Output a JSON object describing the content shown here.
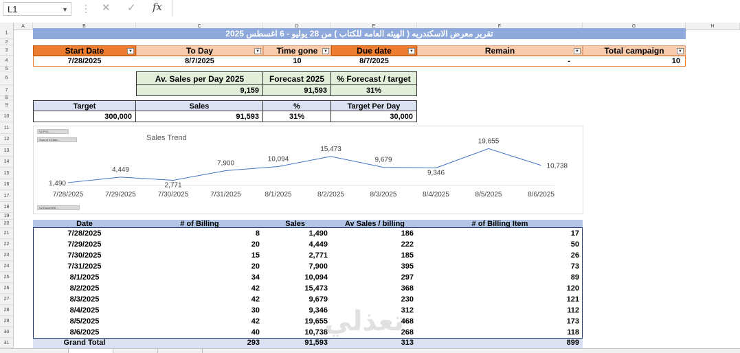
{
  "formula_bar": {
    "name_box": "L1",
    "cancel_icon": "✕",
    "enter_icon": "✓",
    "fx_label": "fx",
    "formula": ""
  },
  "columns": [
    "A",
    "B",
    "C",
    "D",
    "E",
    "F",
    "G",
    "H"
  ],
  "rows": [
    "1",
    "2",
    "3",
    "4",
    "5",
    "6",
    "7",
    "8",
    "9",
    "10",
    "11",
    "12",
    "13",
    "14",
    "15",
    "16",
    "17",
    "18",
    "19",
    "20",
    "21",
    "22",
    "23",
    "24",
    "25",
    "26",
    "27",
    "28",
    "29",
    "30",
    "31"
  ],
  "title": "تقرير معرض الاسكندريه ( الهيئه العامه للكتاب )   من 28 يوليو - 6 اغسطس  2025",
  "campaign": {
    "headers": [
      "Start Date",
      "To Day",
      "Time gone",
      "Due date",
      "Remain",
      "Total campaign"
    ],
    "values": [
      "7/28/2025",
      "8/7/2025",
      "10",
      "8/7/2025",
      "-",
      "10"
    ]
  },
  "forecast": {
    "headers": [
      "Av. Sales per Day 2025",
      "Forecast 2025",
      "% Forecast / target"
    ],
    "values": [
      "9,159",
      "91,593",
      "31%"
    ]
  },
  "target": {
    "headers": [
      "Target",
      "Sales",
      "%",
      "Target Per Day"
    ],
    "values": [
      "300,000",
      "91,593",
      "31%",
      "30,000"
    ]
  },
  "chart_buttons": {
    "filter": "V2.PGI...",
    "values": "Sum of V2.Net...",
    "axis": "V2.Document ..."
  },
  "chart_data": {
    "type": "line",
    "title": "Sales Trend",
    "categories": [
      "7/28/2025",
      "7/29/2025",
      "7/30/2025",
      "7/31/2025",
      "8/1/2025",
      "8/2/2025",
      "8/3/2025",
      "8/4/2025",
      "8/5/2025",
      "8/6/2025"
    ],
    "values": [
      1490,
      4449,
      2771,
      7900,
      10094,
      15473,
      9679,
      9346,
      19655,
      10738
    ],
    "labels": [
      "1,490",
      "4,449",
      "2,771",
      "7,900",
      "10,094",
      "15,473",
      "9,679",
      "9,346",
      "19,655",
      "10,738"
    ],
    "ylim": [
      0,
      22000
    ],
    "color": "#4472c4"
  },
  "pivot": {
    "headers": [
      "Date",
      "# of Billing",
      "Sales",
      "Av  Sales / billing",
      "# of Billing Item"
    ],
    "rows": [
      [
        "7/28/2025",
        "8",
        "1,490",
        "186",
        "17"
      ],
      [
        "7/29/2025",
        "20",
        "4,449",
        "222",
        "50"
      ],
      [
        "7/30/2025",
        "15",
        "2,771",
        "185",
        "26"
      ],
      [
        "7/31/2025",
        "20",
        "7,900",
        "395",
        "73"
      ],
      [
        "8/1/2025",
        "34",
        "10,094",
        "297",
        "89"
      ],
      [
        "8/2/2025",
        "42",
        "15,473",
        "368",
        "120"
      ],
      [
        "8/3/2025",
        "42",
        "9,679",
        "230",
        "121"
      ],
      [
        "8/4/2025",
        "30",
        "9,346",
        "312",
        "112"
      ],
      [
        "8/5/2025",
        "42",
        "19,655",
        "468",
        "173"
      ],
      [
        "8/6/2025",
        "40",
        "10,738",
        "268",
        "118"
      ]
    ],
    "total": [
      "Grand Total",
      "293",
      "91,593",
      "313",
      "899"
    ]
  },
  "watermark": "تعذلي",
  "colors": {
    "title_bg": "#8ea9db",
    "orange": "#ed7d31",
    "peach": "#f8cbad",
    "green": "#e2efda",
    "lavender": "#d9e1f2",
    "pivot_header": "#b4c6e7"
  }
}
